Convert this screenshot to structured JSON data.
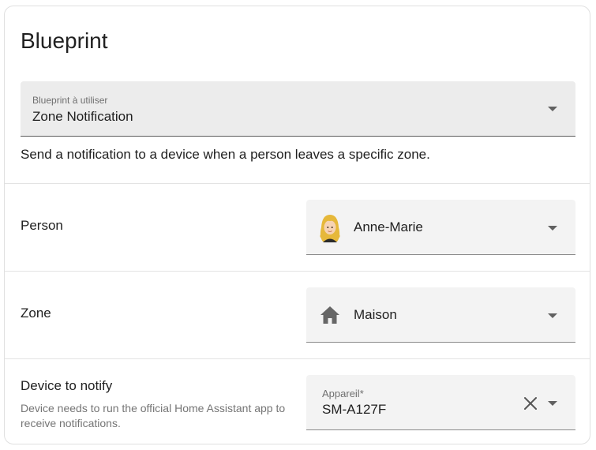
{
  "card": {
    "title": "Blueprint"
  },
  "blueprint_select": {
    "label": "Blueprint à utiliser",
    "value": "Zone Notification"
  },
  "description": "Send a notification to a device when a person leaves a specific zone.",
  "rows": [
    {
      "label": "Person",
      "value": "Anne-Marie",
      "icon": "person-avatar"
    },
    {
      "label": "Zone",
      "value": "Maison",
      "icon": "home-icon"
    },
    {
      "label": "Device to notify",
      "sublabel": "Device needs to run the official Home Assistant app to receive notifications.",
      "field_label": "Appareil*",
      "value": "SM-A127F",
      "icon": "close-icon"
    }
  ]
}
